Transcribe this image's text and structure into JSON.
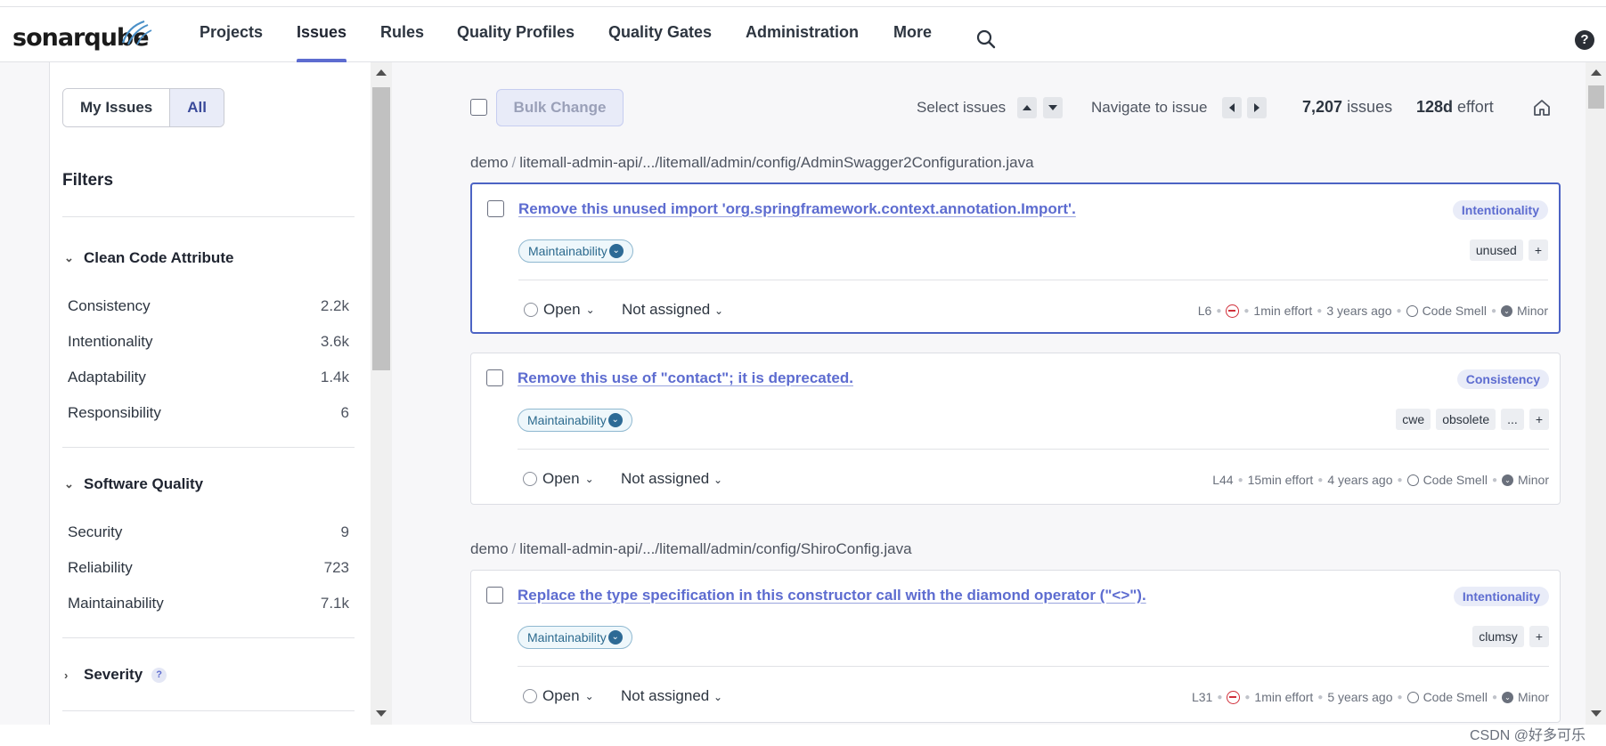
{
  "header": {
    "logo_text": "sonarqube",
    "nav": [
      "Projects",
      "Issues",
      "Rules",
      "Quality Profiles",
      "Quality Gates",
      "Administration",
      "More"
    ],
    "active_nav": "Issues",
    "help": "?"
  },
  "sidebar": {
    "toggle": {
      "my_issues": "My Issues",
      "all": "All",
      "selected": "All"
    },
    "filters_title": "Filters",
    "clean_code_attribute": {
      "title": "Clean Code Attribute",
      "rows": [
        {
          "label": "Consistency",
          "count": "2.2k"
        },
        {
          "label": "Intentionality",
          "count": "3.6k"
        },
        {
          "label": "Adaptability",
          "count": "1.4k"
        },
        {
          "label": "Responsibility",
          "count": "6"
        }
      ]
    },
    "software_quality": {
      "title": "Software Quality",
      "rows": [
        {
          "label": "Security",
          "count": "9"
        },
        {
          "label": "Reliability",
          "count": "723"
        },
        {
          "label": "Maintainability",
          "count": "7.1k"
        }
      ]
    },
    "severity": {
      "title": "Severity",
      "help": "?"
    }
  },
  "toolbar": {
    "bulk_change": "Bulk Change",
    "select_issues": "Select issues",
    "navigate_to_issue": "Navigate to issue",
    "issue_count": "7,207",
    "issues_word": "issues",
    "effort": "128d",
    "effort_word": "effort"
  },
  "groups": [
    {
      "project": "demo",
      "path": "litemall-admin-api/.../litemall/admin/config/AdminSwagger2Configuration.java",
      "issues": [
        {
          "title": "Remove this unused import 'org.springframework.context.annotation.Import'.",
          "attribute": "Intentionality",
          "quality": "Maintainability",
          "tags": [
            "unused",
            "+"
          ],
          "status": "Open",
          "assignee": "Not assigned",
          "line": "L6",
          "effort": "1min effort",
          "age": "3 years ago",
          "type": "Code Smell",
          "severity": "Minor"
        },
        {
          "title": "Remove this use of \"contact\"; it is deprecated.",
          "attribute": "Consistency",
          "quality": "Maintainability",
          "tags": [
            "cwe",
            "obsolete",
            "...",
            "+"
          ],
          "status": "Open",
          "assignee": "Not assigned",
          "line": "L44",
          "effort": "15min effort",
          "age": "4 years ago",
          "type": "Code Smell",
          "severity": "Minor"
        }
      ]
    },
    {
      "project": "demo",
      "path": "litemall-admin-api/.../litemall/admin/config/ShiroConfig.java",
      "issues": [
        {
          "title": "Replace the type specification in this constructor call with the diamond operator (\"<>\").",
          "attribute": "Intentionality",
          "quality": "Maintainability",
          "tags": [
            "clumsy",
            "+"
          ],
          "status": "Open",
          "assignee": "Not assigned",
          "line": "L31",
          "effort": "1min effort",
          "age": "5 years ago",
          "type": "Code Smell",
          "severity": "Minor"
        }
      ]
    }
  ],
  "watermark": "CSDN @好多可乐",
  "colors": {
    "accent": "#5d6cd0",
    "focus_border": "#4c63c4",
    "blocker": "#d02f3a"
  }
}
